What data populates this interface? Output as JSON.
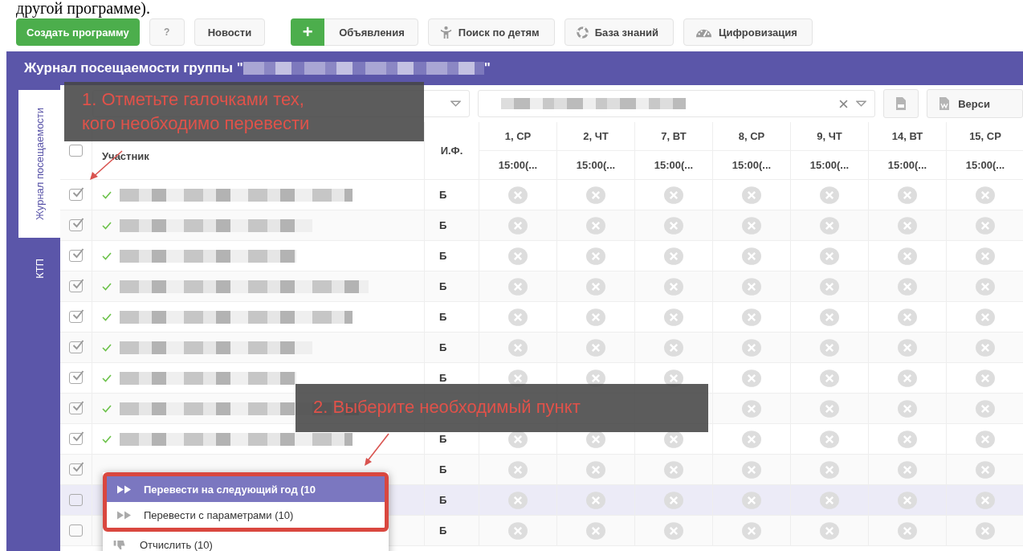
{
  "document_text": "другой программе).",
  "toolbar": [
    {
      "kind": "primary",
      "label": "Создать программу"
    },
    {
      "kind": "help",
      "label": "?"
    },
    {
      "kind": "plain",
      "label": "Новости"
    },
    {
      "kind": "split",
      "icon_text": "+",
      "label": "Объявления"
    },
    {
      "kind": "icon",
      "label": "Поиск по детям"
    },
    {
      "kind": "icon",
      "label": "База знаний"
    },
    {
      "kind": "icon",
      "label": "Цифровизация"
    }
  ],
  "journal": {
    "title": "Журнал посещаемости группы \"",
    "title_end": "\""
  },
  "side_tabs": [
    {
      "label": "Журнал посещаемости",
      "selected": true
    },
    {
      "label": "КТП",
      "selected": false
    }
  ],
  "filters": {
    "version_button": "Верси"
  },
  "columns": {
    "select_all_checked": false,
    "participant": "Участник",
    "initials": "И.Ф.",
    "dates": [
      {
        "day": "1, СР",
        "time": "15:00(..."
      },
      {
        "day": "2, ЧТ",
        "time": "15:00(..."
      },
      {
        "day": "7, ВТ",
        "time": "15:00(..."
      },
      {
        "day": "8, СР",
        "time": "15:00(..."
      },
      {
        "day": "9, ЧТ",
        "time": "15:00(..."
      },
      {
        "day": "14, ВТ",
        "time": "15:00(..."
      },
      {
        "day": "15, СР",
        "time": "15:00(..."
      }
    ]
  },
  "rows": [
    {
      "checked": true,
      "confirmed": true,
      "highlighted": false,
      "group": "Б"
    },
    {
      "checked": true,
      "confirmed": true,
      "highlighted": false,
      "group": "Б"
    },
    {
      "checked": true,
      "confirmed": true,
      "highlighted": false,
      "group": "Б"
    },
    {
      "checked": true,
      "confirmed": true,
      "highlighted": false,
      "group": "Б"
    },
    {
      "checked": true,
      "confirmed": true,
      "highlighted": false,
      "group": "Б"
    },
    {
      "checked": true,
      "confirmed": true,
      "highlighted": false,
      "group": "Б"
    },
    {
      "checked": true,
      "confirmed": true,
      "highlighted": false,
      "group": "Б"
    },
    {
      "checked": true,
      "confirmed": true,
      "highlighted": false
    },
    {
      "checked": true,
      "confirmed": true,
      "highlighted": false,
      "group": "Б"
    },
    {
      "checked": true,
      "confirmed": false,
      "highlighted": false,
      "group": "Б"
    },
    {
      "checked": false,
      "confirmed": false,
      "highlighted": true,
      "group": "Б"
    },
    {
      "checked": false,
      "confirmed": false,
      "highlighted": false,
      "group": "Б"
    }
  ],
  "context_menu": [
    {
      "label": "Перевести на следующий год (10",
      "selected": true
    },
    {
      "label": "Перевести с параметрами (10)",
      "selected": false
    },
    {
      "label": "Отчислить (10)",
      "selected": false
    }
  ],
  "annotations": [
    {
      "lines": [
        "1. Отметьте галочками тех,",
        "кого необходимо перевести"
      ]
    },
    {
      "lines": [
        "2. Выберите необходимый пункт"
      ]
    }
  ]
}
